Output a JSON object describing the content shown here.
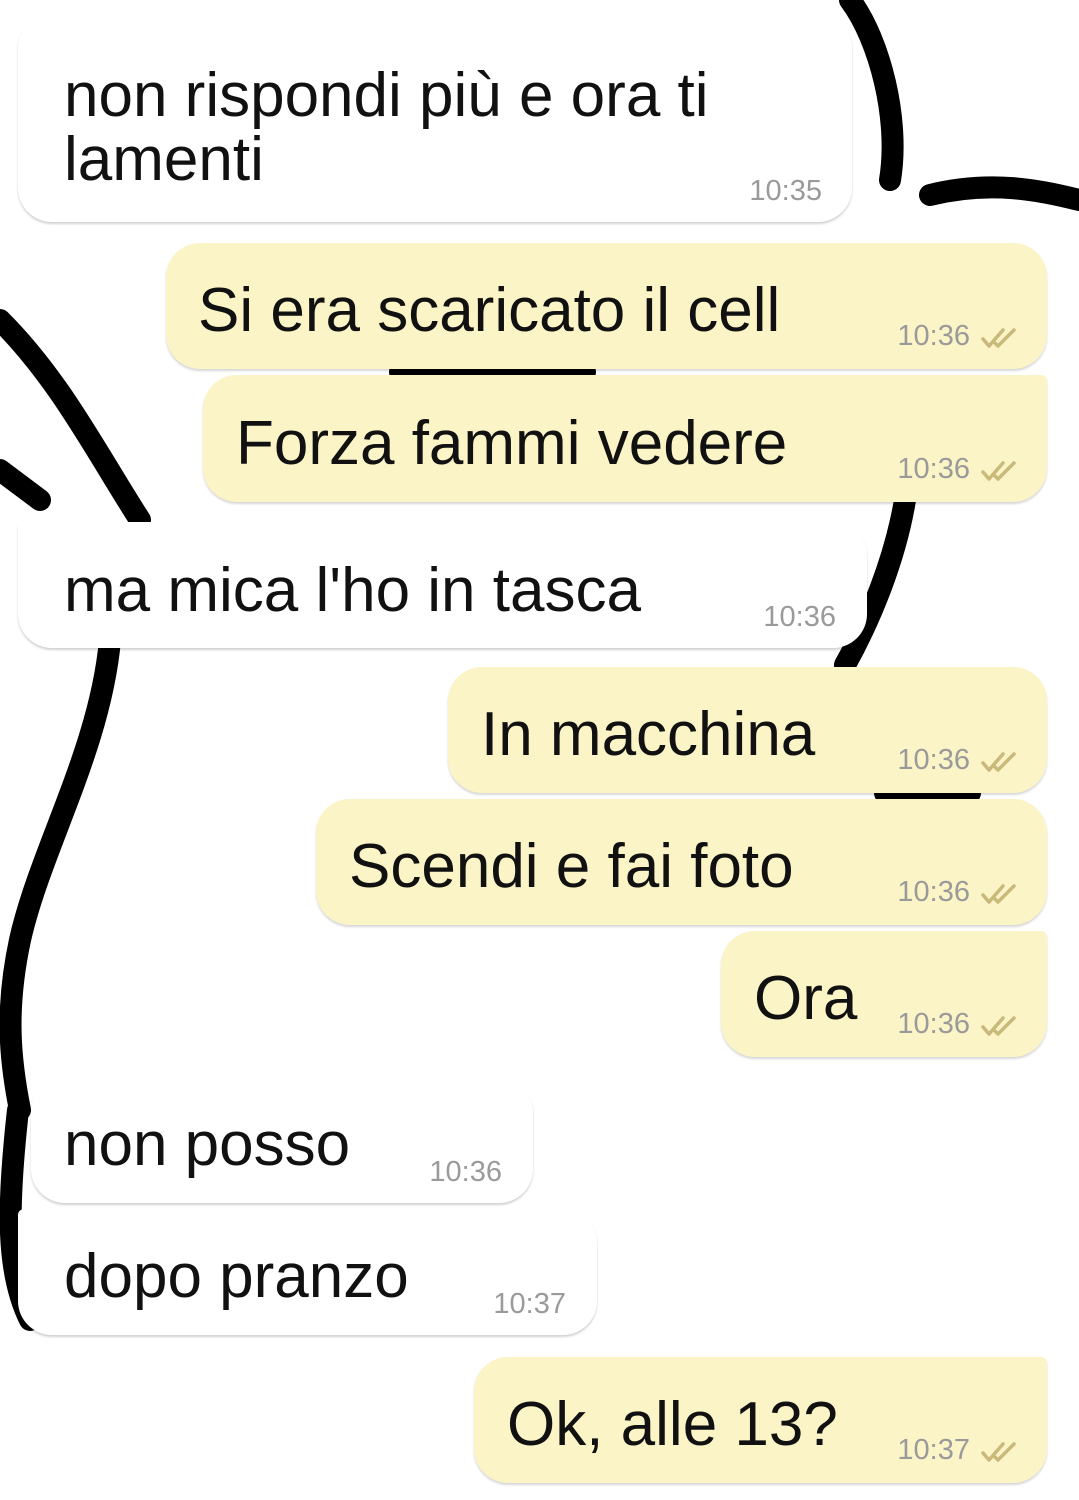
{
  "chat": {
    "messages": [
      {
        "direction": "in",
        "text": "non rispondi più e ora ti\nlamenti",
        "time": "10:35"
      },
      {
        "direction": "out",
        "text": "Si era scaricato il cell",
        "time": "10:36",
        "status_icon": "double-check-icon"
      },
      {
        "direction": "out",
        "text": "Forza fammi vedere",
        "time": "10:36",
        "status_icon": "double-check-icon"
      },
      {
        "direction": "in",
        "text": "ma mica l'ho in tasca",
        "time": "10:36"
      },
      {
        "direction": "out",
        "text": "In macchina",
        "time": "10:36",
        "status_icon": "double-check-icon"
      },
      {
        "direction": "out",
        "text": "Scendi e fai foto",
        "time": "10:36",
        "status_icon": "double-check-icon"
      },
      {
        "direction": "out",
        "text": "Ora",
        "time": "10:36",
        "status_icon": "double-check-icon"
      },
      {
        "direction": "in",
        "text": "non posso",
        "time": "10:36"
      },
      {
        "direction": "in",
        "text": "dopo pranzo",
        "time": "10:37"
      },
      {
        "direction": "out",
        "text": "Ok, alle 13?",
        "time": "10:37",
        "status_icon": "double-check-icon"
      }
    ]
  },
  "colors": {
    "incoming_bubble": "#ffffff",
    "outgoing_bubble": "#fbf4c7",
    "tick": "#c9b97a",
    "time": "#9a9a9a"
  }
}
